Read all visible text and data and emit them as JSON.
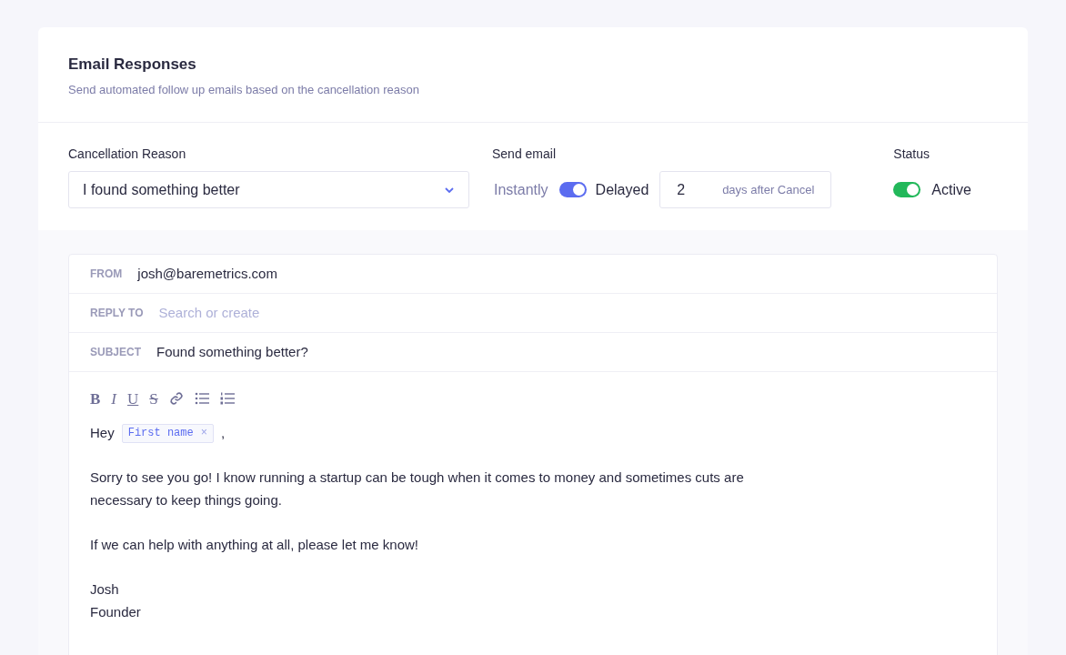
{
  "header": {
    "title": "Email Responses",
    "subtitle": "Send automated follow up emails based on the cancellation reason"
  },
  "settings": {
    "reason_label": "Cancellation Reason",
    "reason_value": "I found something better",
    "send_label": "Send email",
    "instant_label": "Instantly",
    "delayed": true,
    "delayed_label": "Delayed",
    "days_value": "2",
    "days_suffix": "days after Cancel",
    "status_label": "Status",
    "active": true,
    "active_label": "Active"
  },
  "email": {
    "from_label": "FROM",
    "from_value": "josh@baremetrics.com",
    "reply_label": "REPLY TO",
    "reply_placeholder": "Search or create",
    "subject_label": "SUBJECT",
    "subject_value": "Found something better?",
    "toolbar": [
      {
        "kind": "bold",
        "label": "B"
      },
      {
        "kind": "italic",
        "label": "I"
      },
      {
        "kind": "underline",
        "label": "U"
      },
      {
        "kind": "strike",
        "label": "S"
      },
      {
        "kind": "link"
      },
      {
        "kind": "bullets"
      },
      {
        "kind": "numbers"
      }
    ],
    "greeting": "Hey",
    "tag": "First name",
    "tag_remove": "×",
    "greeting_end": ",",
    "paragraphs": [
      "Sorry to see you go! I know running a startup can be tough when it comes to money and sometimes cuts are necessary to keep things going.",
      "If we can help with anything at all, please let me know!"
    ],
    "signature": [
      "Josh",
      "Founder"
    ]
  }
}
